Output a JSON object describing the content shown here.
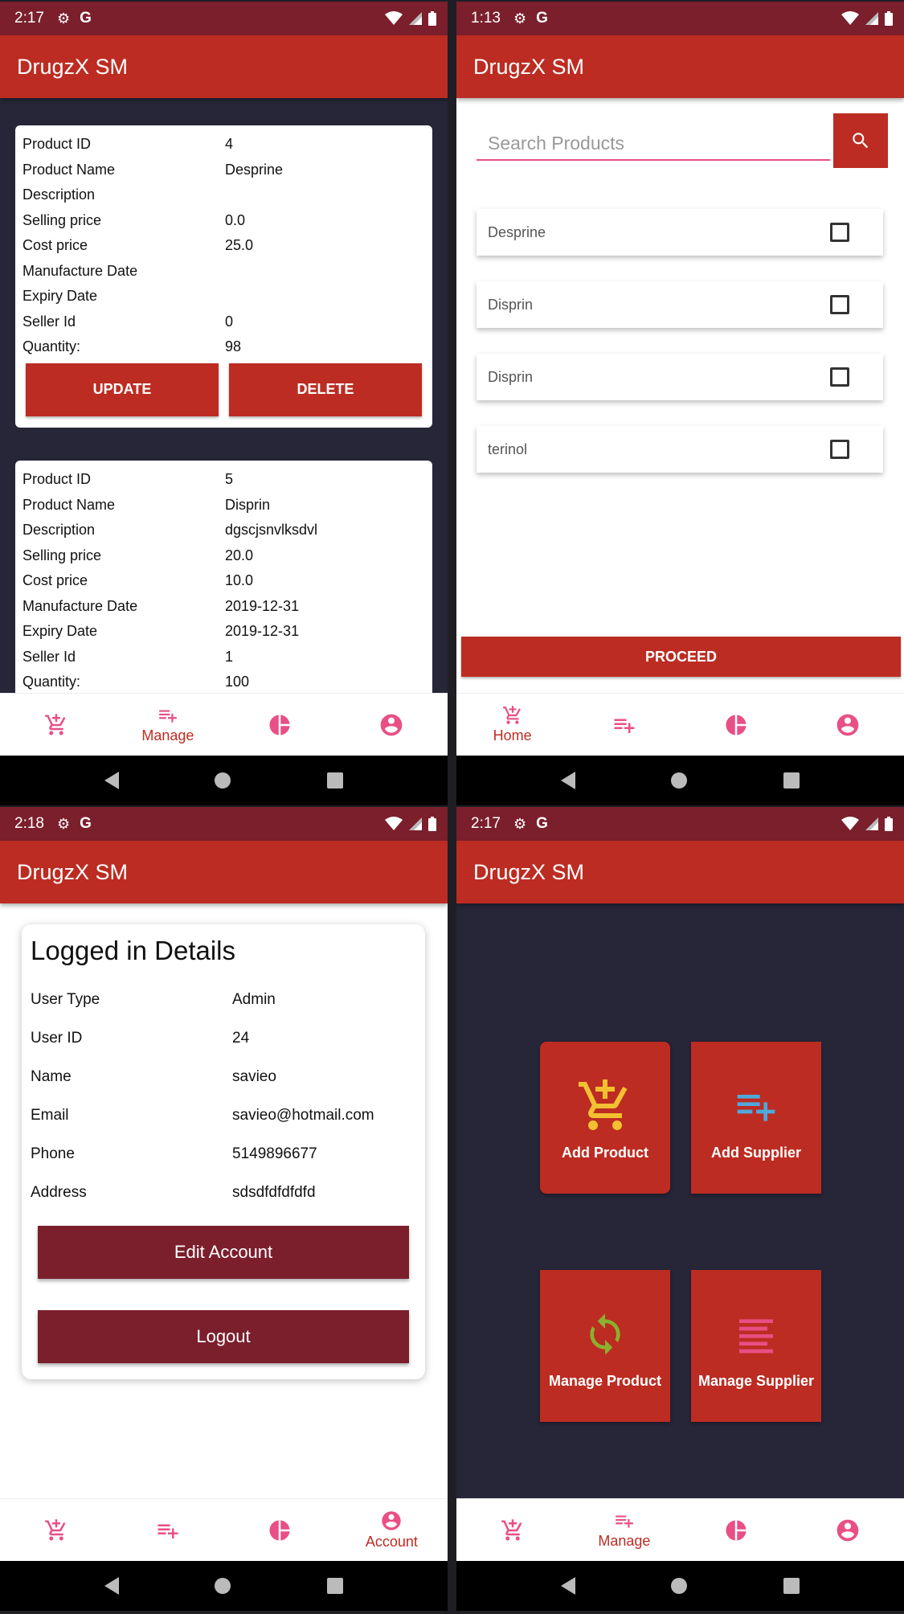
{
  "app": {
    "title": "DrugzX SM"
  },
  "colors": {
    "primary": "#bc2c22",
    "primary_dark": "#7b1f2c",
    "accent": "#e94f86",
    "background_dark": "#262638"
  },
  "screens": {
    "manage_products": {
      "status_time": "2:17",
      "field_labels": [
        "Product ID",
        "Product Name",
        "Description",
        "Selling price",
        "Cost price",
        "Manufacture Date",
        "Expiry Date",
        "Seller Id",
        "Quantity:"
      ],
      "products": [
        {
          "values": [
            "4",
            "Desprine",
            "",
            "0.0",
            "25.0",
            "",
            "",
            "0",
            "98"
          ],
          "update_label": "UPDATE",
          "delete_label": "DELETE"
        },
        {
          "values": [
            "5",
            "Disprin",
            "dgscjsnvlksdvl",
            "20.0",
            "10.0",
            "2019-12-31",
            "2019-12-31",
            "1",
            "100"
          ]
        }
      ],
      "active_nav_label": "Manage"
    },
    "home": {
      "status_time": "1:13",
      "search": {
        "placeholder": "Search Products"
      },
      "items": [
        "Desprine",
        "Disprin",
        "Disprin",
        "terinol"
      ],
      "proceed_label": "PROCEED",
      "active_nav_label": "Home"
    },
    "account": {
      "status_time": "2:18",
      "card_title": "Logged in Details",
      "rows": [
        {
          "label": "User Type",
          "value": "Admin"
        },
        {
          "label": "User ID",
          "value": "24"
        },
        {
          "label": "Name",
          "value": "savieo"
        },
        {
          "label": "Email",
          "value": "savieo@hotmail.com"
        },
        {
          "label": "Phone",
          "value": "5149896677"
        },
        {
          "label": "Address",
          "value": "sdsdfdfdfdfd"
        }
      ],
      "edit_label": "Edit Account",
      "logout_label": "Logout",
      "active_nav_label": "Account"
    },
    "manage_menu": {
      "status_time": "2:17",
      "tiles": [
        "Add Product",
        "Add Supplier",
        "Manage Product",
        "Manage Supplier"
      ],
      "active_nav_label": "Manage"
    }
  },
  "icons": {
    "status": [
      "gear-icon",
      "google-icon",
      "wifi-icon",
      "signal-icon",
      "battery-icon"
    ],
    "nav": [
      "cart-plus-icon",
      "playlist-add-icon",
      "pie-chart-icon",
      "account-circle-icon"
    ],
    "system": [
      "back-icon",
      "home-circle-icon",
      "recents-square-icon"
    ]
  }
}
